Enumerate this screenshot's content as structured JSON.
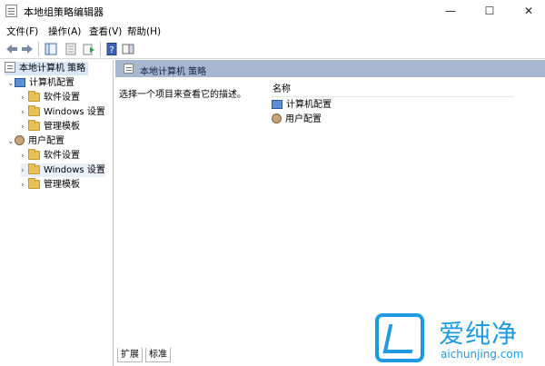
{
  "window": {
    "title": "本地组策略编辑器"
  },
  "window_controls": {
    "minimize": "—",
    "maximize": "☐",
    "close": "✕"
  },
  "menu": [
    "文件(F)",
    "操作(A)",
    "查看(V)",
    "帮助(H)"
  ],
  "toolbar": {
    "back_icon": "arrow-left-icon",
    "forward_icon": "arrow-right-icon"
  },
  "tree": {
    "root": "本地计算机 策略",
    "nodes": [
      {
        "label": "计算机配置",
        "children": [
          "软件设置",
          "Windows 设置",
          "管理模板"
        ]
      },
      {
        "label": "用户配置",
        "children": [
          "软件设置",
          "Windows 设置",
          "管理模板"
        ]
      }
    ]
  },
  "content": {
    "header": "本地计算机 策略",
    "description": "选择一个项目来查看它的描述。",
    "column_name": "名称",
    "items": [
      "计算机配置",
      "用户配置"
    ]
  },
  "tabs": [
    "扩展",
    "标准"
  ],
  "watermark": {
    "brand": "爱纯净",
    "url": "aichunjing.com"
  }
}
